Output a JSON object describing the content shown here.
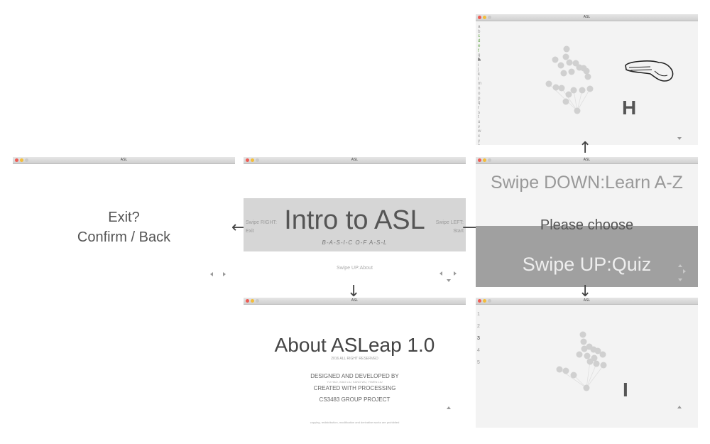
{
  "window_title": "ASL",
  "exit_screen": {
    "line1": "Exit?",
    "line2": "Confirm / Back"
  },
  "intro_screen": {
    "title": "Intro to ASL",
    "subtitle_glyphs": "B-A-S-I-C  O-F  A-S-L",
    "swipe_right": "Swipe RIGHT:",
    "exit": "Exit",
    "swipe_left": "Swipe LEFT:",
    "start": "Start",
    "swipe_up": "Swipe UP:About"
  },
  "about_screen": {
    "title": "About ASLeap 1.0",
    "rights": "2016 ALL RIGHT RESERVED",
    "designed": "DESIGNED AND DEVELOPED BY",
    "names": "YU HAO, XIAO LIU, KANG WU, YIWEN LIU",
    "created": "CREATED WITH PROCESSING",
    "project": "CS3483 GROUP PROJECT",
    "footer": "copying, redistribution, modification and derivative works are prohibited"
  },
  "choose_screen": {
    "learn": "Swipe DOWN:Learn A-Z",
    "prompt": "Please choose",
    "quiz": "Swipe UP:Quiz"
  },
  "learn_screen": {
    "alphabet": [
      "a",
      "b",
      "c",
      "d",
      "e",
      "f",
      "g",
      "h",
      "i",
      "j",
      "k",
      "l",
      "m",
      "n",
      "o",
      "p",
      "q",
      "r",
      "s",
      "t",
      "u",
      "v",
      "w",
      "x",
      "y",
      "z"
    ],
    "letter": "H"
  },
  "quiz_screen": {
    "numbers": [
      "1",
      "2",
      "3",
      "4",
      "5"
    ],
    "letter": "I"
  },
  "icons": {
    "left": "triangle-left-icon",
    "right": "triangle-right-icon",
    "up": "triangle-up-icon",
    "down": "triangle-down-icon"
  },
  "colors": {
    "close": "#ee5c54",
    "minimize": "#f3bd3a",
    "banner": "#a0a0a0",
    "title_band": "#d6d6d6"
  }
}
